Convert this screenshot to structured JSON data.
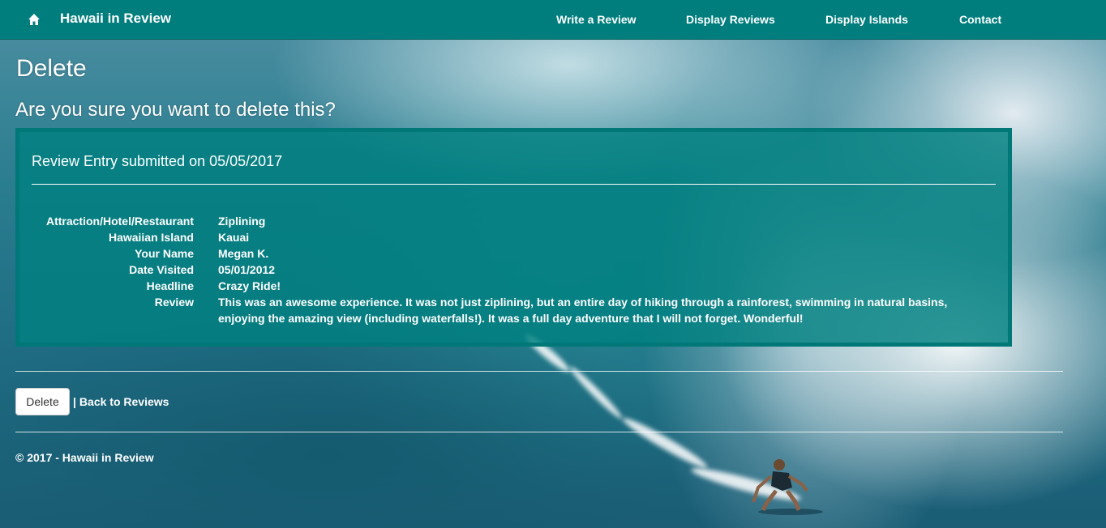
{
  "navbar": {
    "brand": "Hawaii in Review",
    "home_icon": "home-icon",
    "links": [
      "Write a Review",
      "Display Reviews",
      "Display Islands",
      "Contact"
    ],
    "color": "#007d7d"
  },
  "page": {
    "title": "Delete",
    "confirm_question": "Are you sure you want to delete this?"
  },
  "review": {
    "heading": "Review Entry submitted on 05/05/2017",
    "fields": [
      {
        "label": "Attraction/Hotel/Restaurant",
        "value": "Ziplining"
      },
      {
        "label": "Hawaiian Island",
        "value": "Kauai"
      },
      {
        "label": "Your Name",
        "value": "Megan K."
      },
      {
        "label": "Date Visited",
        "value": "05/01/2012"
      },
      {
        "label": "Headline",
        "value": "Crazy Ride!"
      },
      {
        "label": "Review",
        "value": "This was an awesome experience. It was not just ziplining, but an entire day of hiking through a rainforest, swimming in natural basins, enjoying the amazing view (including waterfalls!). It was a full day adventure that I will not forget. Wonderful!"
      }
    ]
  },
  "actions": {
    "delete_label": "Delete",
    "separator": "|",
    "back_label": "Back to Reviews"
  },
  "footer": {
    "copyright": "© 2017 - Hawaii in Review"
  }
}
